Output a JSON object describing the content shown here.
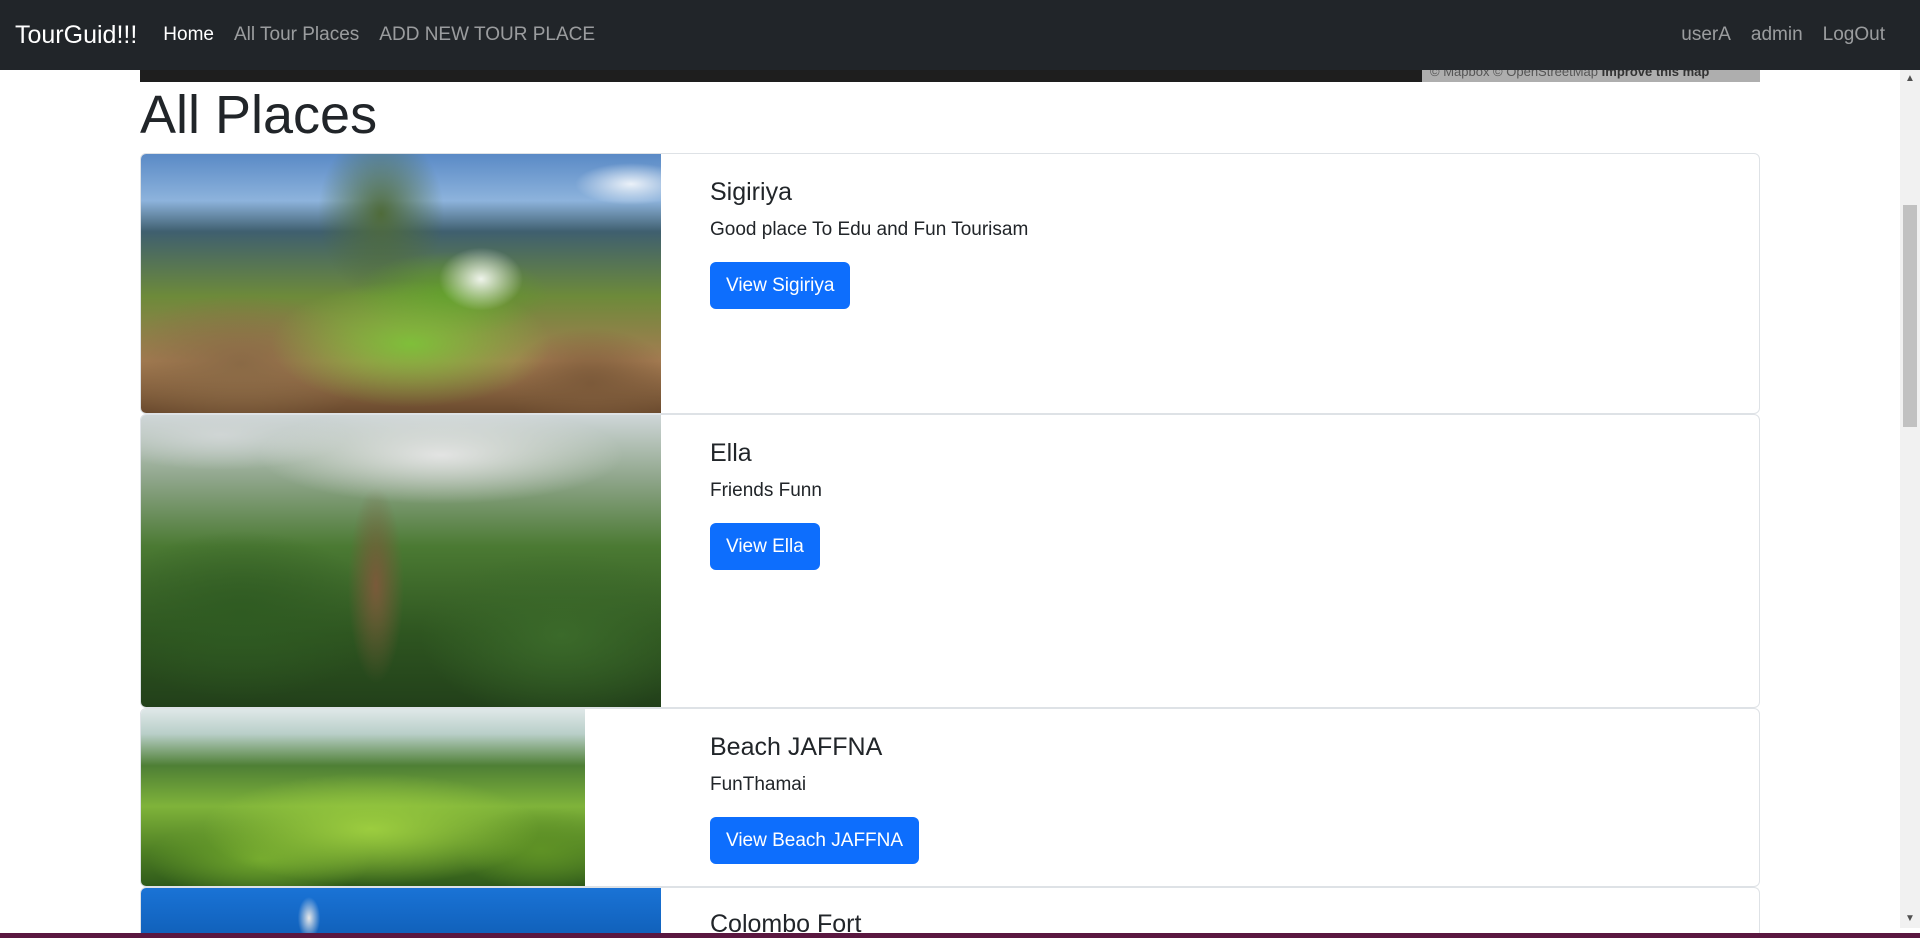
{
  "navbar": {
    "brand": "TourGuid!!!",
    "links": [
      {
        "label": "Home",
        "active": true
      },
      {
        "label": "All Tour Places",
        "active": false
      },
      {
        "label": "ADD NEW TOUR PLACE",
        "active": false
      }
    ],
    "right_links": [
      {
        "label": "userA"
      },
      {
        "label": "admin"
      },
      {
        "label": "LogOut"
      }
    ]
  },
  "map": {
    "attribution_text": "© Mapbox © OpenStreetMap",
    "improve_link": "Improve this map"
  },
  "page_title": "All Places",
  "places": [
    {
      "title": "Sigiriya",
      "description": "Good place To Edu and Fun Tourisam",
      "button_label": "View Sigiriya"
    },
    {
      "title": "Ella",
      "description": "Friends Funn",
      "button_label": "View Ella"
    },
    {
      "title": "Beach JAFFNA",
      "description": "FunThamai",
      "button_label": "View Beach JAFFNA"
    },
    {
      "title": "Colombo Fort",
      "description": "",
      "button_label": ""
    }
  ],
  "colors": {
    "navbar_bg": "#212529",
    "primary_button": "#0d6efd",
    "text": "#212529"
  },
  "icons": {
    "scroll_up": "triangle-up-icon",
    "scroll_down": "triangle-down-icon"
  }
}
